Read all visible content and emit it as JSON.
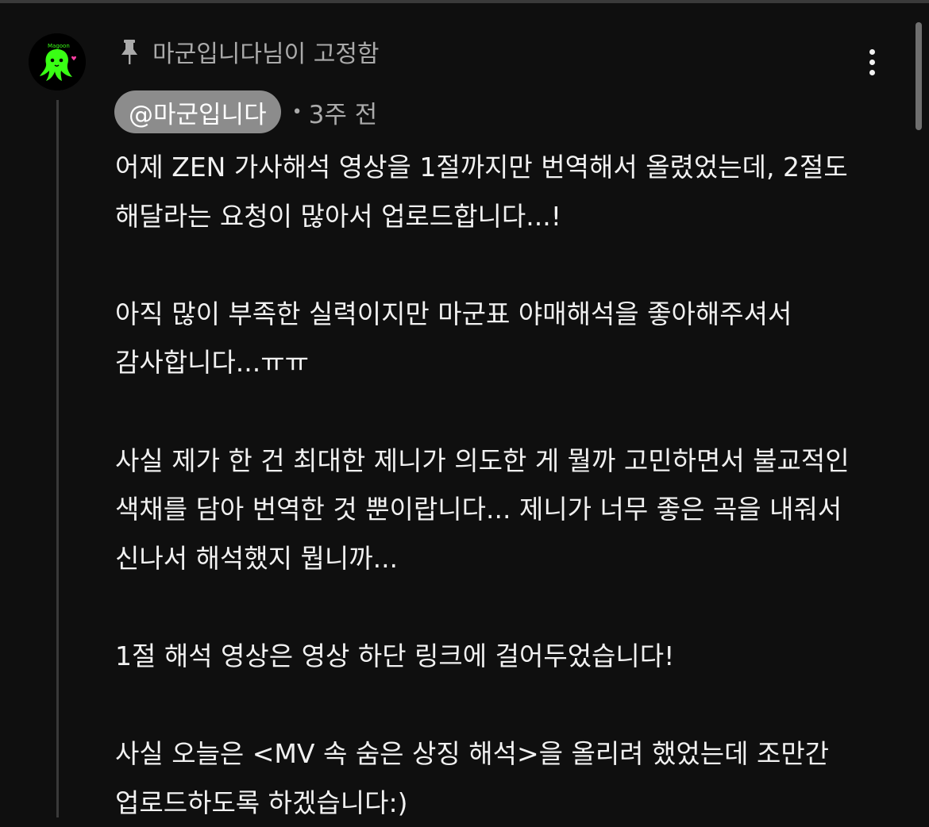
{
  "comment": {
    "pinned_label": "마군입니다님이 고정함",
    "author": "@마군입니다",
    "separator": "•",
    "timestamp": "3주 전",
    "body": "어제 ZEN 가사해석 영상을 1절까지만 번역해서 올렸었는데, 2절도 해달라는 요청이 많아서 업로드합니다...!\n\n아직 많이 부족한 실력이지만 마군표 야매해석을 좋아해주셔서 감사합니다...ㅠㅠ\n\n사실 제가 한 건 최대한 제니가 의도한 게 뭘까 고민하면서 불교적인 색채를 담아 번역한 것 뿐이랍니다... 제니가 너무 좋은 곡을 내줘서 신나서 해석했지 뭡니까...\n\n1절 해석 영상은 영상 하단 링크에 걸어두었습니다!\n\n사실 오늘은 <MV 속 숨은 상징 해석>을 올리려 했었는데 조만간 업로드하도록 하겠습니다:)",
    "avatar_text": "Magoon"
  },
  "icons": {
    "pin": "pin-icon",
    "more": "more-vert-icon",
    "avatar": "green-octopus-avatar"
  },
  "colors": {
    "background": "#0f0f0f",
    "text": "#f1f1f1",
    "secondary_text": "#aaaaaa",
    "author_chip": "#8c8c8c",
    "avatar_green": "#39ff14",
    "avatar_heart": "#ff3fa4"
  }
}
